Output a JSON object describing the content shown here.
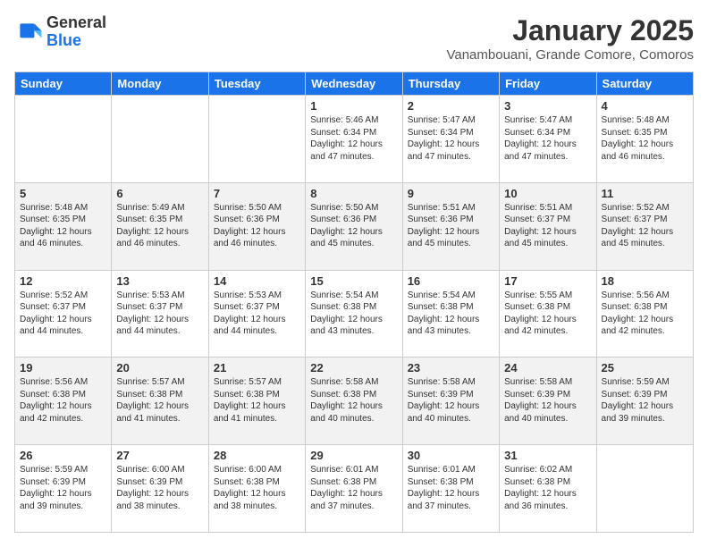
{
  "header": {
    "logo_general": "General",
    "logo_blue": "Blue",
    "month_title": "January 2025",
    "location": "Vanambouani, Grande Comore, Comoros"
  },
  "days_of_week": [
    "Sunday",
    "Monday",
    "Tuesday",
    "Wednesday",
    "Thursday",
    "Friday",
    "Saturday"
  ],
  "weeks": [
    [
      {
        "day": "",
        "info": ""
      },
      {
        "day": "",
        "info": ""
      },
      {
        "day": "",
        "info": ""
      },
      {
        "day": "1",
        "info": "Sunrise: 5:46 AM\nSunset: 6:34 PM\nDaylight: 12 hours and 47 minutes."
      },
      {
        "day": "2",
        "info": "Sunrise: 5:47 AM\nSunset: 6:34 PM\nDaylight: 12 hours and 47 minutes."
      },
      {
        "day": "3",
        "info": "Sunrise: 5:47 AM\nSunset: 6:34 PM\nDaylight: 12 hours and 47 minutes."
      },
      {
        "day": "4",
        "info": "Sunrise: 5:48 AM\nSunset: 6:35 PM\nDaylight: 12 hours and 46 minutes."
      }
    ],
    [
      {
        "day": "5",
        "info": "Sunrise: 5:48 AM\nSunset: 6:35 PM\nDaylight: 12 hours and 46 minutes."
      },
      {
        "day": "6",
        "info": "Sunrise: 5:49 AM\nSunset: 6:35 PM\nDaylight: 12 hours and 46 minutes."
      },
      {
        "day": "7",
        "info": "Sunrise: 5:50 AM\nSunset: 6:36 PM\nDaylight: 12 hours and 46 minutes."
      },
      {
        "day": "8",
        "info": "Sunrise: 5:50 AM\nSunset: 6:36 PM\nDaylight: 12 hours and 45 minutes."
      },
      {
        "day": "9",
        "info": "Sunrise: 5:51 AM\nSunset: 6:36 PM\nDaylight: 12 hours and 45 minutes."
      },
      {
        "day": "10",
        "info": "Sunrise: 5:51 AM\nSunset: 6:37 PM\nDaylight: 12 hours and 45 minutes."
      },
      {
        "day": "11",
        "info": "Sunrise: 5:52 AM\nSunset: 6:37 PM\nDaylight: 12 hours and 45 minutes."
      }
    ],
    [
      {
        "day": "12",
        "info": "Sunrise: 5:52 AM\nSunset: 6:37 PM\nDaylight: 12 hours and 44 minutes."
      },
      {
        "day": "13",
        "info": "Sunrise: 5:53 AM\nSunset: 6:37 PM\nDaylight: 12 hours and 44 minutes."
      },
      {
        "day": "14",
        "info": "Sunrise: 5:53 AM\nSunset: 6:37 PM\nDaylight: 12 hours and 44 minutes."
      },
      {
        "day": "15",
        "info": "Sunrise: 5:54 AM\nSunset: 6:38 PM\nDaylight: 12 hours and 43 minutes."
      },
      {
        "day": "16",
        "info": "Sunrise: 5:54 AM\nSunset: 6:38 PM\nDaylight: 12 hours and 43 minutes."
      },
      {
        "day": "17",
        "info": "Sunrise: 5:55 AM\nSunset: 6:38 PM\nDaylight: 12 hours and 42 minutes."
      },
      {
        "day": "18",
        "info": "Sunrise: 5:56 AM\nSunset: 6:38 PM\nDaylight: 12 hours and 42 minutes."
      }
    ],
    [
      {
        "day": "19",
        "info": "Sunrise: 5:56 AM\nSunset: 6:38 PM\nDaylight: 12 hours and 42 minutes."
      },
      {
        "day": "20",
        "info": "Sunrise: 5:57 AM\nSunset: 6:38 PM\nDaylight: 12 hours and 41 minutes."
      },
      {
        "day": "21",
        "info": "Sunrise: 5:57 AM\nSunset: 6:38 PM\nDaylight: 12 hours and 41 minutes."
      },
      {
        "day": "22",
        "info": "Sunrise: 5:58 AM\nSunset: 6:38 PM\nDaylight: 12 hours and 40 minutes."
      },
      {
        "day": "23",
        "info": "Sunrise: 5:58 AM\nSunset: 6:39 PM\nDaylight: 12 hours and 40 minutes."
      },
      {
        "day": "24",
        "info": "Sunrise: 5:58 AM\nSunset: 6:39 PM\nDaylight: 12 hours and 40 minutes."
      },
      {
        "day": "25",
        "info": "Sunrise: 5:59 AM\nSunset: 6:39 PM\nDaylight: 12 hours and 39 minutes."
      }
    ],
    [
      {
        "day": "26",
        "info": "Sunrise: 5:59 AM\nSunset: 6:39 PM\nDaylight: 12 hours and 39 minutes."
      },
      {
        "day": "27",
        "info": "Sunrise: 6:00 AM\nSunset: 6:39 PM\nDaylight: 12 hours and 38 minutes."
      },
      {
        "day": "28",
        "info": "Sunrise: 6:00 AM\nSunset: 6:38 PM\nDaylight: 12 hours and 38 minutes."
      },
      {
        "day": "29",
        "info": "Sunrise: 6:01 AM\nSunset: 6:38 PM\nDaylight: 12 hours and 37 minutes."
      },
      {
        "day": "30",
        "info": "Sunrise: 6:01 AM\nSunset: 6:38 PM\nDaylight: 12 hours and 37 minutes."
      },
      {
        "day": "31",
        "info": "Sunrise: 6:02 AM\nSunset: 6:38 PM\nDaylight: 12 hours and 36 minutes."
      },
      {
        "day": "",
        "info": ""
      }
    ]
  ]
}
